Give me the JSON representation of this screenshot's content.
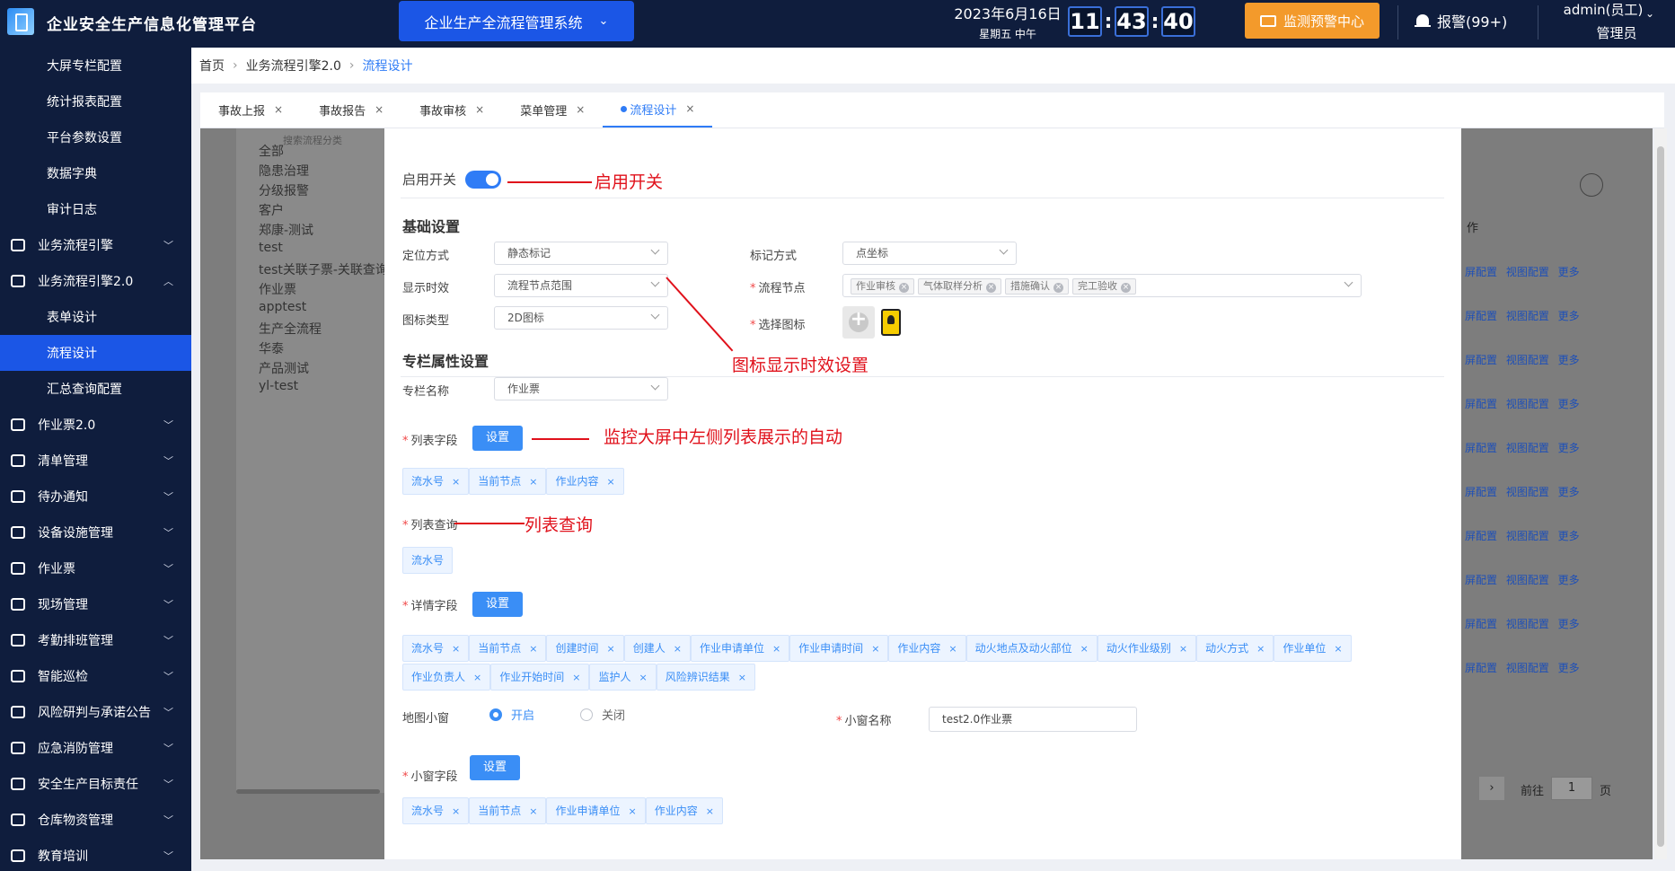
{
  "header": {
    "app_title": "企业安全生产信息化管理平台",
    "system_switch": "企业生产全流程管理系统",
    "date": "2023年6月16日",
    "weekday": "星期五 中午",
    "clock": {
      "h": "11",
      "m": "43",
      "s": "40"
    },
    "monitor_btn": "监测预警中心",
    "alarm": "报警(99+)",
    "user_name": "admin(员工)",
    "user_role": "管理员"
  },
  "sidebar": {
    "items": [
      {
        "label": "大屏专栏配置",
        "level": "sub"
      },
      {
        "label": "统计报表配置",
        "level": "sub"
      },
      {
        "label": "平台参数设置",
        "level": "sub"
      },
      {
        "label": "数据字典",
        "level": "sub"
      },
      {
        "label": "审计日志",
        "level": "sub"
      },
      {
        "label": "业务流程引擎",
        "level": "top",
        "icon": "workflow-icon"
      },
      {
        "label": "业务流程引擎2.0",
        "level": "top",
        "icon": "workflow-tree-icon",
        "expanded": true
      },
      {
        "label": "表单设计",
        "level": "sub"
      },
      {
        "label": "流程设计",
        "level": "sub",
        "active": true
      },
      {
        "label": "汇总查询配置",
        "level": "sub"
      },
      {
        "label": "作业票2.0",
        "level": "top",
        "icon": "ticket-icon"
      },
      {
        "label": "清单管理",
        "level": "top",
        "icon": "list-icon"
      },
      {
        "label": "待办通知",
        "level": "top",
        "icon": "mail-icon"
      },
      {
        "label": "设备设施管理",
        "level": "top",
        "icon": "device-icon"
      },
      {
        "label": "作业票",
        "level": "top",
        "icon": "work-ticket-icon"
      },
      {
        "label": "现场管理",
        "level": "top",
        "icon": "site-icon"
      },
      {
        "label": "考勤排班管理",
        "level": "top",
        "icon": "chart-icon"
      },
      {
        "label": "智能巡检",
        "level": "top",
        "icon": "grid-icon"
      },
      {
        "label": "风险研判与承诺公告",
        "level": "top",
        "icon": "lock-icon"
      },
      {
        "label": "应急消防管理",
        "level": "top",
        "icon": "fire-icon"
      },
      {
        "label": "安全生产目标责任",
        "level": "top",
        "icon": "target-icon"
      },
      {
        "label": "仓库物资管理",
        "level": "top",
        "icon": "folder-icon"
      },
      {
        "label": "教育培训",
        "level": "top",
        "icon": "training-icon"
      }
    ]
  },
  "breadcrumb": {
    "home": "首页",
    "parent": "业务流程引擎2.0",
    "current": "流程设计"
  },
  "tabs": [
    {
      "label": "事故上报",
      "close": "×"
    },
    {
      "label": "事故报告",
      "close": "×"
    },
    {
      "label": "事故审核",
      "close": "×"
    },
    {
      "label": "菜单管理",
      "close": "×"
    },
    {
      "label": "流程设计",
      "close": "×",
      "active": true
    }
  ],
  "background": {
    "search_placeholder": "搜索流程分类",
    "categories": [
      "全部",
      "隐患治理",
      "分级报警",
      "客户",
      "郑康-测试",
      "test",
      "test关联子票-关联查询",
      "作业票",
      "apptest",
      "生产全流程",
      "华泰",
      "产品测试",
      "yl-test"
    ],
    "column_head": "作",
    "row_actions": "屏配置 视图配置 更多",
    "pager_prefix": "前往",
    "pager_value": "1",
    "pager_suffix": "页",
    "next": "›"
  },
  "form": {
    "enable_label": "启用开关",
    "basic_title": "基础设置",
    "locate_label": "定位方式",
    "locate_value": "静态标记",
    "mark_label": "标记方式",
    "mark_value": "点坐标",
    "display_label": "显示时效",
    "display_value": "流程节点范围",
    "node_label": "流程节点",
    "node_tags": [
      "作业审核",
      "气体取样分析",
      "措施确认",
      "完工验收"
    ],
    "icon_type_label": "图标类型",
    "icon_type_value": "2D图标",
    "choose_icon_label": "选择图标",
    "column_title": "专栏属性设置",
    "column_name_label": "专栏名称",
    "column_name_value": "作业票",
    "list_field_label": "列表字段",
    "set_btn": "设置",
    "list_field_tags": [
      "流水号",
      "当前节点",
      "作业内容"
    ],
    "list_query_label": "列表查询",
    "list_query_tags": [
      "流水号"
    ],
    "detail_field_label": "详情字段",
    "detail_tags_row1": [
      "流水号",
      "当前节点",
      "创建时间",
      "创建人",
      "作业申请单位",
      "作业申请时间",
      "作业内容",
      "动火地点及动火部位",
      "动火作业级别",
      "动火方式",
      "作业单位"
    ],
    "detail_tags_row2": [
      "作业负责人",
      "作业开始时间",
      "监护人",
      "风险辨识结果"
    ],
    "map_window_label": "地图小窗",
    "radio_on": "开启",
    "radio_off": "关闭",
    "window_name_label": "小窗名称",
    "window_name_value": "test2.0作业票",
    "window_field_label": "小窗字段",
    "window_field_tags": [
      "流水号",
      "当前节点",
      "作业申请单位",
      "作业内容"
    ],
    "tag_close": "×"
  },
  "annotations": {
    "enable_note": "启用开关",
    "display_note": "图标显示时效设置",
    "list_field_note": "监控大屏中左侧列表展示的自动",
    "list_query_note": "列表查询"
  },
  "colors": {
    "sidebar_bg": "#0f1d3d",
    "primary": "#1b56e6",
    "accent": "#f39a2b",
    "annotation": "#e0111b"
  }
}
